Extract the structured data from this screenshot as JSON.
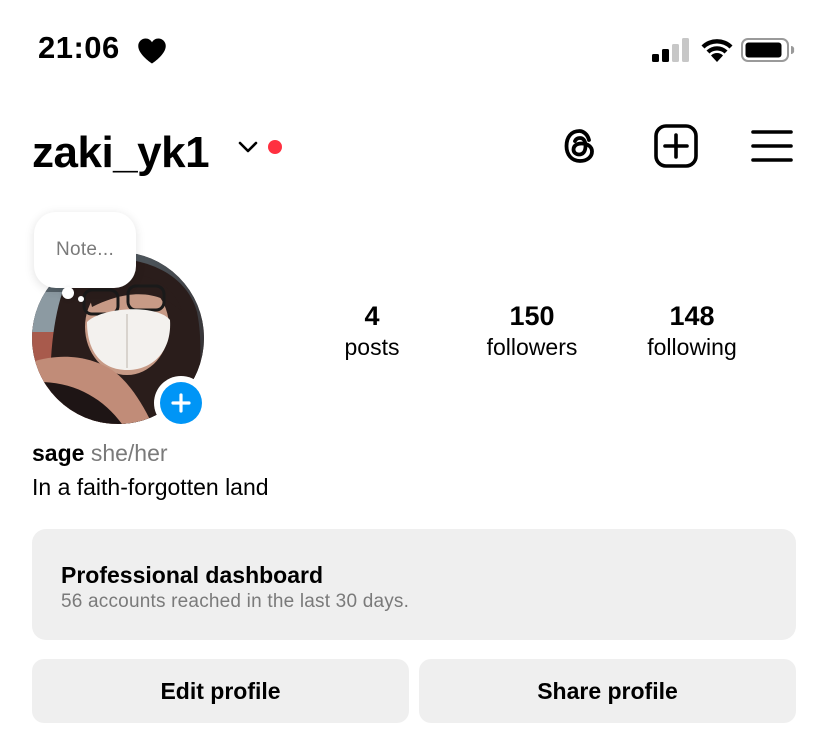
{
  "status_bar": {
    "time": "21:06",
    "heart_icon": "heart-icon",
    "signal_icon": "cellular-signal-icon",
    "wifi_icon": "wifi-icon",
    "battery_icon": "battery-icon"
  },
  "header": {
    "username": "zaki_yk1",
    "dropdown_icon": "chevron-down-icon",
    "notification_dot_color": "#ff3040",
    "threads_icon": "threads-icon",
    "new_post_icon": "plus-square-icon",
    "menu_icon": "hamburger-menu-icon"
  },
  "profile": {
    "note_placeholder": "Note...",
    "add_story_icon": "plus-icon",
    "stats": [
      {
        "value": "4",
        "label": "posts"
      },
      {
        "value": "150",
        "label": "followers"
      },
      {
        "value": "148",
        "label": "following"
      }
    ],
    "name": "sage",
    "pronouns": "she/her",
    "bio": "In a faith-forgotten land"
  },
  "dashboard": {
    "title": "Professional dashboard",
    "subtitle": "56 accounts reached in the last 30 days."
  },
  "actions": {
    "edit_profile": "Edit profile",
    "share_profile": "Share profile"
  },
  "colors": {
    "accent_blue": "#0095f6",
    "button_bg": "#efefef",
    "secondary_text": "#7a7a7a"
  }
}
